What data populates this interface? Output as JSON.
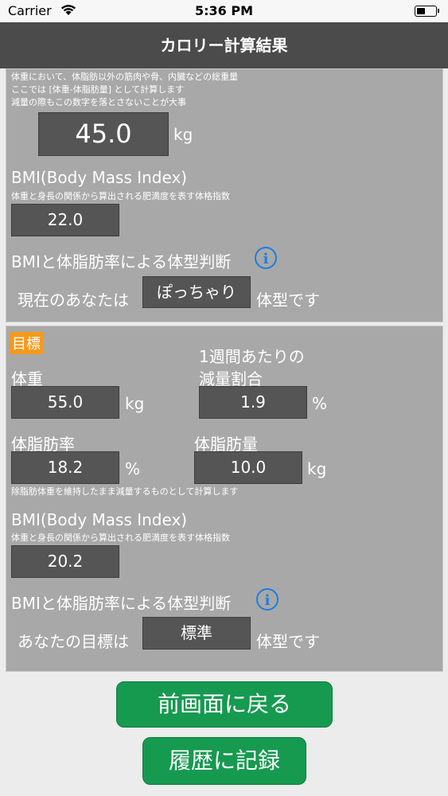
{
  "status_bar": {
    "carrier": "Carrier",
    "time": "5:36 PM"
  },
  "nav": {
    "title": "カロリー計算結果"
  },
  "current": {
    "note_line1": "体重において、体脂肪以外の筋肉や骨、内臓などの総重量",
    "note_line2": "ここでは [体重-体脂肪量] として計算します",
    "note_line3": "減量の際もこの数字を落とさないことが大事",
    "lean_mass": "45.0",
    "lean_mass_unit": "kg",
    "bmi_title": "BMI(Body Mass Index)",
    "bmi_desc": "体重と身長の関係から算出される肥満度を表す体格指数",
    "bmi_value": "22.0",
    "judge_title": "BMIと体脂肪率による体型判断",
    "judge_prefix": "現在のあなたは",
    "judge_value": "ぽっちゃり",
    "judge_suffix": "体型です"
  },
  "target": {
    "badge": "目標",
    "weight_label": "体重",
    "weight_value": "55.0",
    "weight_unit": "kg",
    "rate_label_line1": "1週間あたりの",
    "rate_label_line2": "減量割合",
    "rate_value": "1.9",
    "rate_unit": "%",
    "bodyfat_label": "体脂肪率",
    "bodyfat_value": "18.2",
    "bodyfat_unit": "%",
    "fatmass_label": "体脂肪量",
    "fatmass_value": "10.0",
    "fatmass_unit": "kg",
    "note": "除脂肪体重を維持したまま減量するものとして計算します",
    "bmi_title": "BMI(Body Mass Index)",
    "bmi_desc": "体重と身長の関係から算出される肥満度を表す体格指数",
    "bmi_value": "20.2",
    "judge_title": "BMIと体脂肪率による体型判断",
    "judge_prefix": "あなたの目標は",
    "judge_value": "標準",
    "judge_suffix": "体型です"
  },
  "buttons": {
    "back": "前画面に戻る",
    "record": "履歴に記録"
  },
  "icons": {
    "info": "i"
  }
}
